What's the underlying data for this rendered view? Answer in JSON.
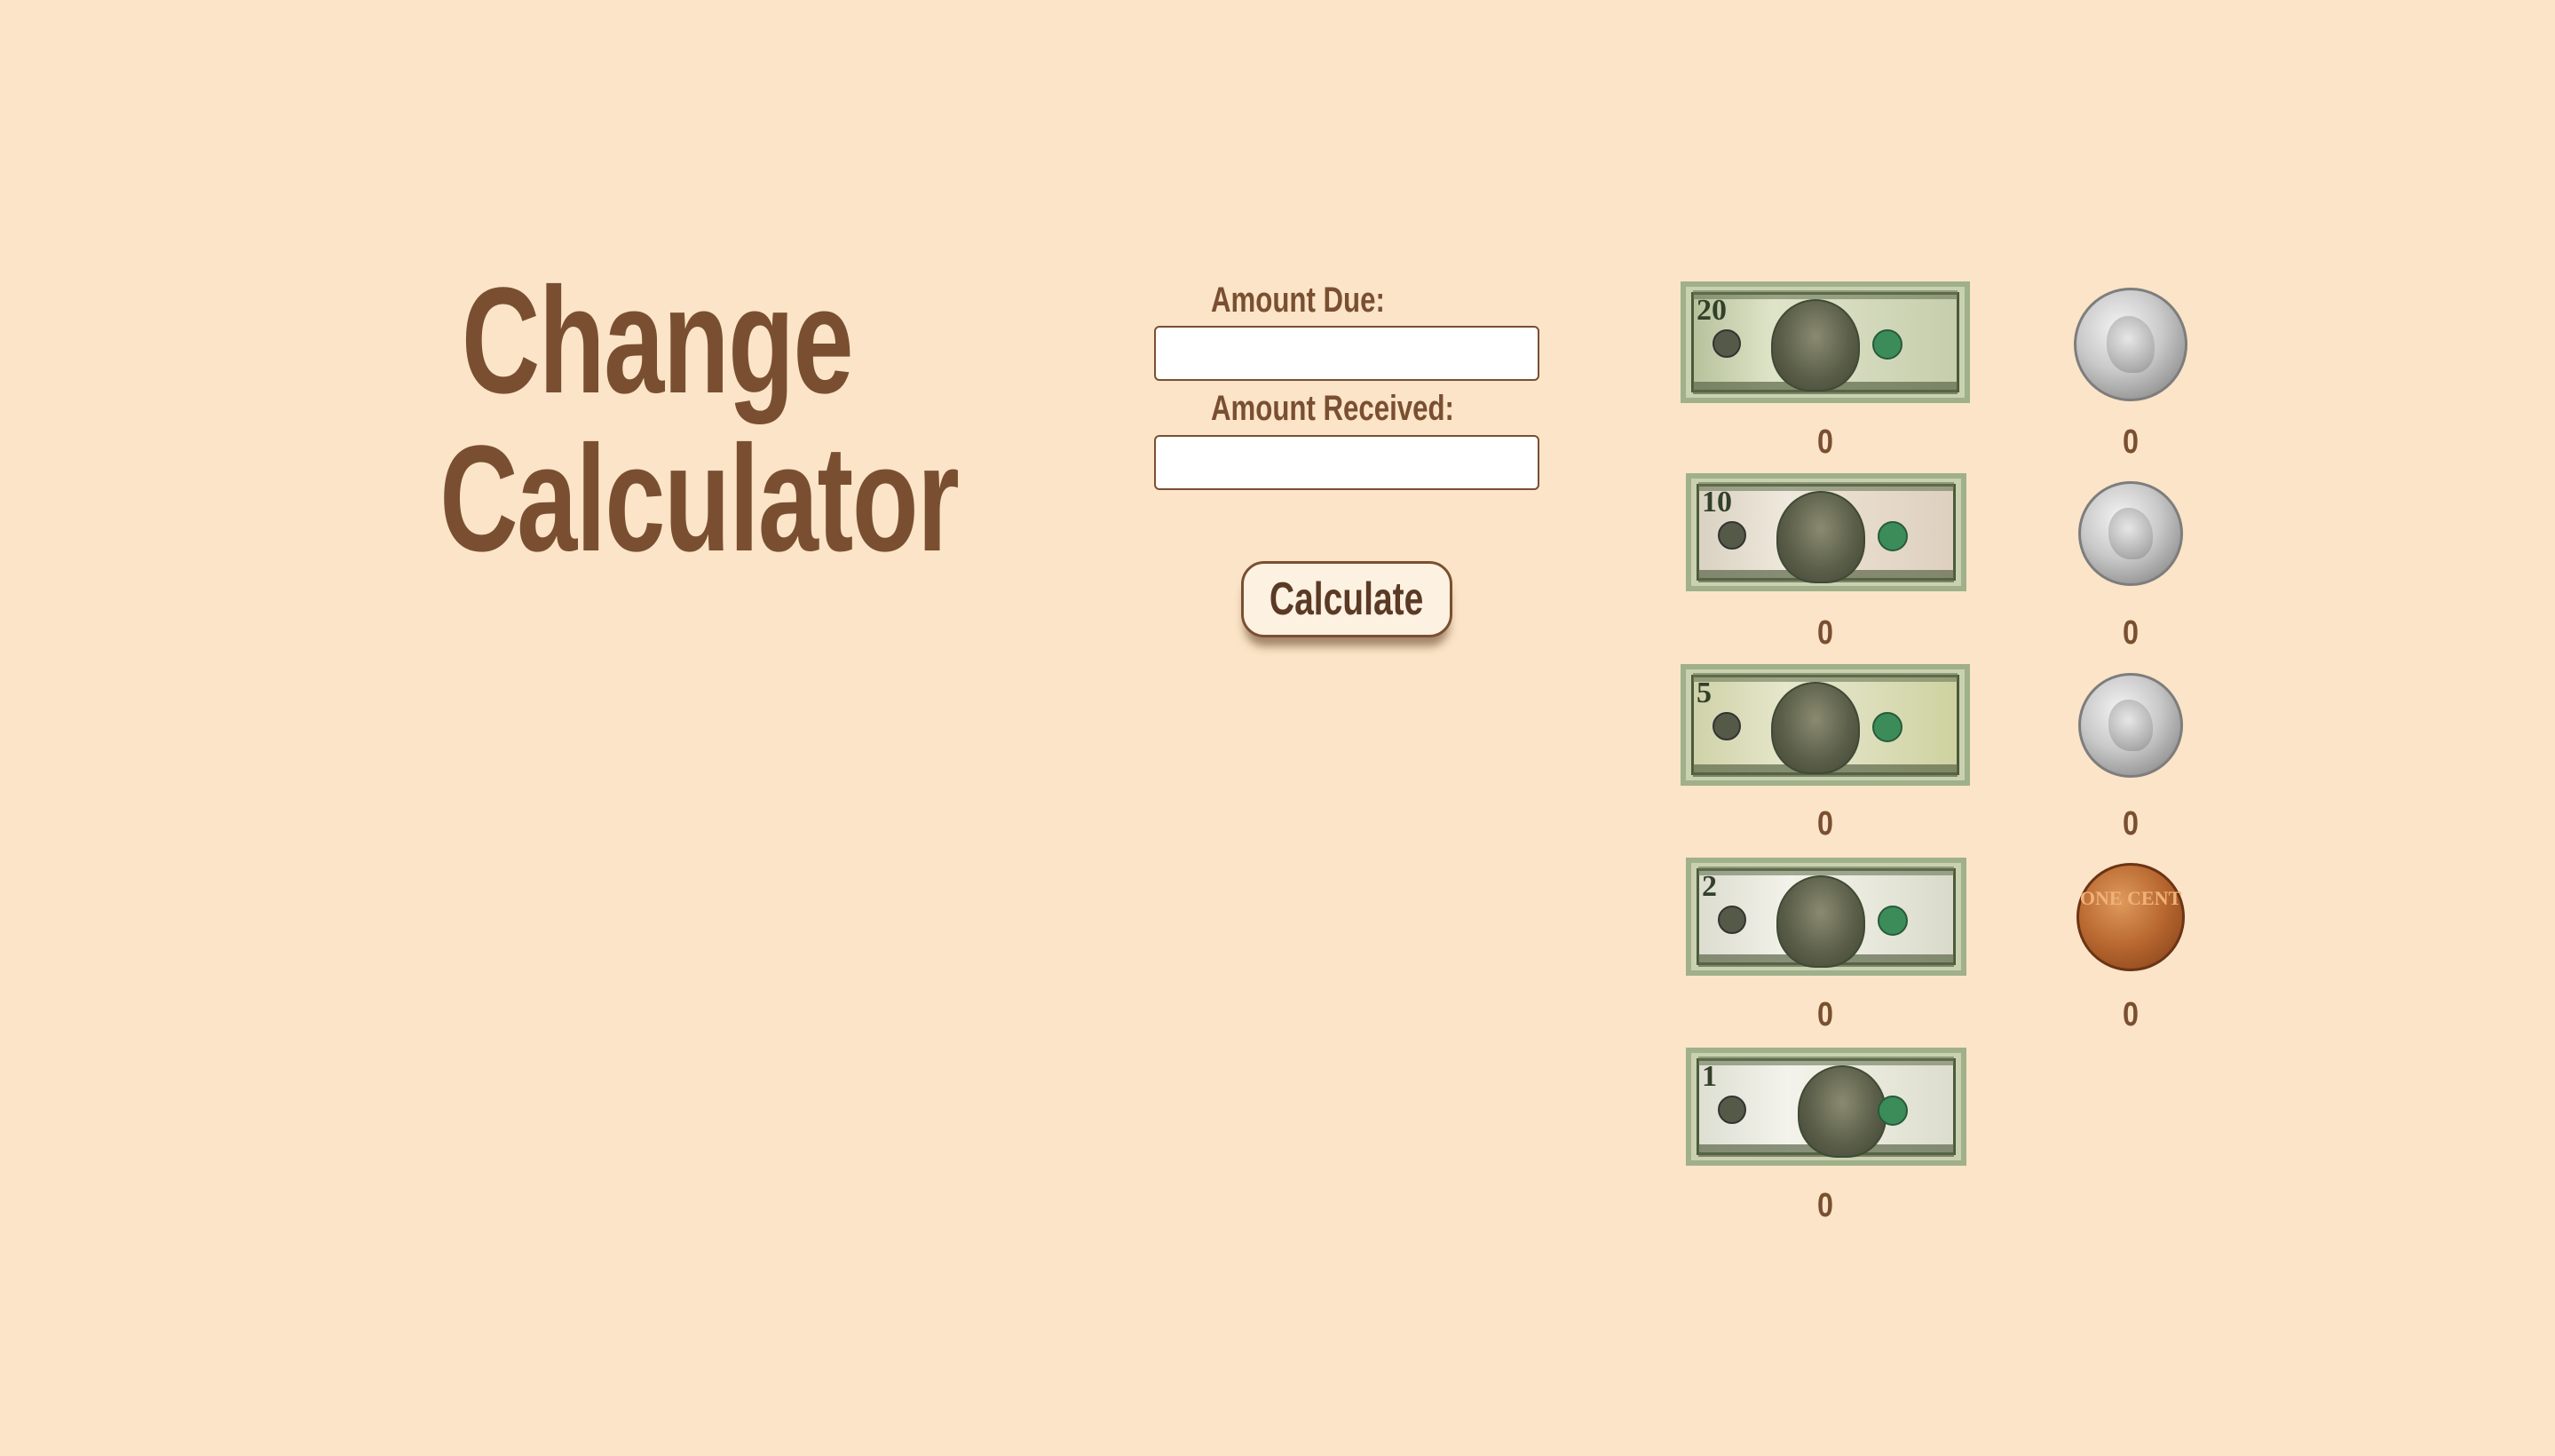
{
  "title": {
    "line1": "Change",
    "line2": "Calculator"
  },
  "form": {
    "amount_due_label": "Amount Due:",
    "amount_due_value": "",
    "amount_received_label": "Amount Received:",
    "amount_received_value": "",
    "calculate_label": "Calculate"
  },
  "bills": [
    {
      "denomination": "20",
      "count": "0"
    },
    {
      "denomination": "10",
      "count": "0"
    },
    {
      "denomination": "5",
      "count": "0"
    },
    {
      "denomination": "2",
      "count": "0"
    },
    {
      "denomination": "1",
      "count": "0"
    }
  ],
  "coins": [
    {
      "name": "quarter",
      "count": "0"
    },
    {
      "name": "dime",
      "count": "0"
    },
    {
      "name": "nickel",
      "count": "0"
    },
    {
      "name": "penny",
      "count": "0",
      "inscription": "ONE CENT"
    }
  ],
  "colors": {
    "background": "#fbe4c7",
    "text": "#7a4f31",
    "button_bg": "#fdf1e2"
  }
}
